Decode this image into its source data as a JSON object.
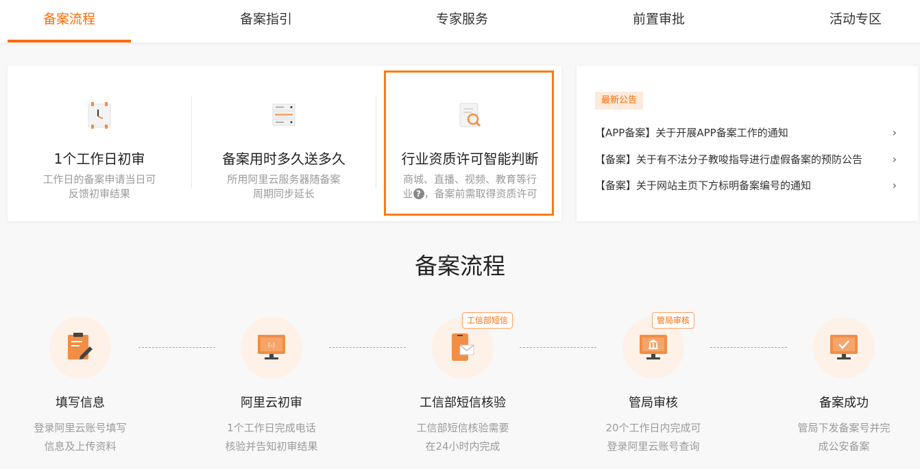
{
  "tabs": [
    {
      "label": "备案流程",
      "active": true
    },
    {
      "label": "备案指引",
      "active": false
    },
    {
      "label": "专家服务",
      "active": false
    },
    {
      "label": "前置审批",
      "active": false
    },
    {
      "label": "活动专区",
      "active": false
    }
  ],
  "features": [
    {
      "icon": "clock-icon",
      "title": "1个工作日初审",
      "desc_line1": "工作日的备案申请当日可",
      "desc_line2": "反馈初审结果"
    },
    {
      "icon": "server-icon",
      "title": "备案用时多久送多久",
      "desc_line1": "所用阿里云服务器随备案",
      "desc_line2": "周期同步延长"
    },
    {
      "icon": "document-search-icon",
      "title": "行业资质许可智能判断",
      "desc_line1": "商城、直播、视频、教育等行",
      "desc_line2_a": "业",
      "desc_line2_b": "，备案前需取得资质许可"
    }
  ],
  "announcements": {
    "badge": "最新公告",
    "items": [
      "【APP备案】关于开展APP备案工作的通知",
      "【备案】关于有不法分子教唆指导进行虚假备案的预防公告",
      "【备案】关于网站主页下方标明备案编号的通知"
    ]
  },
  "process": {
    "title": "备案流程",
    "steps": [
      {
        "icon": "clipboard-edit-icon",
        "title": "填写信息",
        "desc_line1": "登录阿里云账号填写",
        "desc_line2": "信息及上传资料",
        "tag": ""
      },
      {
        "icon": "monitor-icon",
        "title": "阿里云初审",
        "desc_line1": "1个工作日完成电话",
        "desc_line2": "核验并告知初审结果",
        "tag": ""
      },
      {
        "icon": "phone-mail-icon",
        "title": "工信部短信核验",
        "desc_line1": "工信部短信核验需要",
        "desc_line2": "在24小时内完成",
        "tag": "工信部短信"
      },
      {
        "icon": "bank-monitor-icon",
        "title": "管局审核",
        "desc_line1": "20个工作日内完成可",
        "desc_line2": "登录阿里云账号查询",
        "tag": "管局审核"
      },
      {
        "icon": "check-monitor-icon",
        "title": "备案成功",
        "desc_line1": "管局下发备案号并完",
        "desc_line2": "成公安备案",
        "tag": ""
      }
    ]
  },
  "colors": {
    "accent": "#ff6a00",
    "icon_fill": "#f28d45",
    "circle_bg": "#fdf1e8"
  }
}
